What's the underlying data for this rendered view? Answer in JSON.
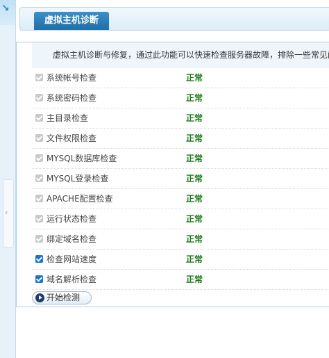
{
  "header": {
    "title": "虚拟主机诊断"
  },
  "description": "虚拟主机诊断与修复，通过此功能可以快速检查服务器故障，排除一些常见问题",
  "checks": [
    {
      "label": "系统帐号检查",
      "status": "正常",
      "checked": true,
      "enabled": false
    },
    {
      "label": "系统密码检查",
      "status": "正常",
      "checked": true,
      "enabled": false
    },
    {
      "label": "主目录检查",
      "status": "正常",
      "checked": true,
      "enabled": false
    },
    {
      "label": "文件权限检查",
      "status": "正常",
      "checked": true,
      "enabled": false
    },
    {
      "label": "MYSQL数据库检查",
      "status": "正常",
      "checked": true,
      "enabled": false
    },
    {
      "label": "MYSQL登录检查",
      "status": "正常",
      "checked": true,
      "enabled": false
    },
    {
      "label": "APACHE配置检查",
      "status": "正常",
      "checked": true,
      "enabled": false
    },
    {
      "label": "运行状态检查",
      "status": "正常",
      "checked": true,
      "enabled": false
    },
    {
      "label": "绑定域名检查",
      "status": "正常",
      "checked": true,
      "enabled": false
    },
    {
      "label": "检查网站速度",
      "status": "正常",
      "checked": true,
      "enabled": true
    },
    {
      "label": "域名解析检查",
      "status": "正常",
      "checked": true,
      "enabled": true
    }
  ],
  "start_button": {
    "label": "开始检测"
  },
  "colors": {
    "status_ok": "#1b7a16",
    "accent": "#1f6fa8",
    "checkbox_on": "#1a73d8"
  }
}
